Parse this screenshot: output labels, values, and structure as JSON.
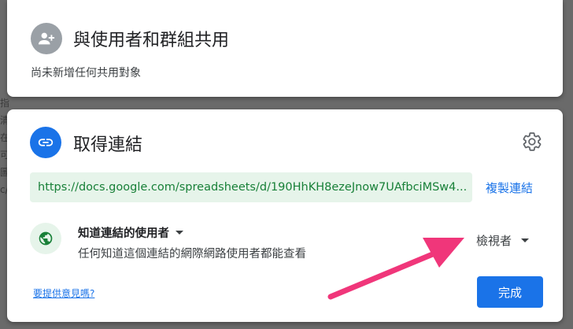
{
  "background": {
    "lines": [
      "指",
      "清",
      "在",
      "可",
      "",
      "",
      "",
      "",
      "圖",
      "c/"
    ]
  },
  "share": {
    "title": "與使用者和群組共用",
    "subtitle": "尚未新增任何共用對象",
    "avatar_icon": "person-add-icon"
  },
  "link": {
    "title": "取得連結",
    "icon": "link-icon",
    "settings_icon": "gear-icon",
    "url": "https://docs.google.com/spreadsheets/d/190HhKH8ezeJnow7UAfbciMSw4...",
    "copy_label": "複製連結",
    "access": {
      "icon": "globe-icon",
      "title": "知道連結的使用者",
      "description": "任何知道這個連結的網際網路使用者都能查看"
    },
    "role": "檢視者",
    "feedback_label": "要提供意見嗎?",
    "done_label": "完成"
  },
  "colors": {
    "accent": "#1a73e8",
    "url_bg": "#e6f4ea",
    "url_text": "#188038",
    "annotation_arrow": "#f0367a"
  }
}
